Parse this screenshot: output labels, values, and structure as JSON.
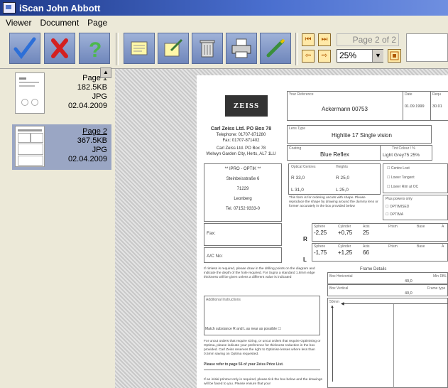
{
  "window": {
    "title": "iScan John Abbott"
  },
  "menu": [
    "Viewer",
    "Document",
    "Page"
  ],
  "toolbar": {
    "buttons": [
      {
        "name": "check-icon"
      },
      {
        "name": "reject-x-icon"
      },
      {
        "name": "help-question-icon"
      },
      {
        "name": "notes-icon"
      },
      {
        "name": "edit-notes-icon"
      },
      {
        "name": "trash-icon"
      },
      {
        "name": "printer-icon"
      },
      {
        "name": "pen-icon"
      }
    ],
    "page_indicator": "Page 2 of 2",
    "zoom": "25%",
    "nav": {
      "first": "⏮",
      "last": "⏭",
      "prev": "⇦",
      "next": "⇨"
    }
  },
  "sidebar": {
    "items": [
      {
        "title": "Page 1",
        "size": "182.5KB",
        "type": "JPG",
        "date": "02.04.2009"
      },
      {
        "title": "Page 2",
        "size": "367.5KB",
        "type": "JPG",
        "date": "02.04.2009"
      }
    ]
  },
  "doc": {
    "logo": "ZEISS",
    "company": "Carl Zeiss Ltd. PO Box 78",
    "telephone": "Telephone: 01707-871280",
    "fax_no": "Fax: 01707-871402",
    "address1": "Carl Zeiss Ltd. PO Box 78",
    "address2": "Welwyn Garden City, Herts, AL7 1LU",
    "your_reference_label": "Your Reference",
    "your_reference": "Ackermann 00753",
    "date_label": "Date",
    "date": "01.09.1999",
    "req_label": "Requ",
    "req_value": "30.01",
    "lens_type_label": "Lens Type",
    "lens_type": "Highlite 17 Single vision",
    "coating_label": "Coating",
    "coating": "Blue Reflex",
    "tint_label": "Tint Colour / %",
    "tint": "Light Grey75 25%",
    "customer": [
      "** IPRO - OPTIK **",
      "Steinbeisstraße 6",
      "71229",
      "Leonberg",
      "Tel. 07152 9333-0"
    ],
    "optical_centres_label": "Optical Centres",
    "heights_label": "Heights",
    "oc_r": "R 33,0",
    "h_r": "R 25,0",
    "oc_l": "L 31,0",
    "h_l": "L 25,0",
    "form_note": "This form is for ordering uncuts with shape. Please reproduce the shape by drawing around the dummy lens or former accurately in the box provided below",
    "options": [
      "Centre Lost",
      "Lower Tangent",
      "Lower Rim at OC"
    ],
    "plus_label": "Plus powers only",
    "plus_options": [
      "OPTIMISED",
      "OPTIMA"
    ],
    "fax_label": "Fax:",
    "ac_label": "A/C No:",
    "rx_headers": [
      "Sphere",
      "Cylinder",
      "Axis",
      "Prism",
      "Base",
      "A"
    ],
    "r_label": "R",
    "l_label": "L",
    "r_values": [
      "-2,25",
      "+0,75",
      "25"
    ],
    "l_values": [
      "-1,75",
      "+1,25",
      "66"
    ],
    "rimless_note": "If rimless is required, please draw in the drilling points on the diagram and indicate the depth of the hole required. For Supra a standard 1.8mm edge thickness will be given unless a different value is indicated",
    "frame_details_label": "Frame Details",
    "box_horizontal_label": "Box Horizontal",
    "box_horizontal": "40,0",
    "min_dbl_label": "Min DBL",
    "box_vertical_label": "Box Vertical",
    "box_vertical": "40,0",
    "frame_type_label": "Frame type",
    "additional_label": "Additional Instructions",
    "match_label": "Match substance R and L as near as possible",
    "uncut_note": "For uncut orders that require sizing, or uncut orders that require Optimising or Optima, please indicate your preference for thickness reduction in the box provided. Carl Zeiss reserves the right to Optimise lenses where less than 0.5mm saving on Optima requested.",
    "refer_note": "Please refer to page 56 of your Zeiss Price List.",
    "initial_note": "If an initial printout only is required, please tick the box below and the drawings will be faxed to you. Please ensure that your",
    "mm_label": "50mm"
  }
}
